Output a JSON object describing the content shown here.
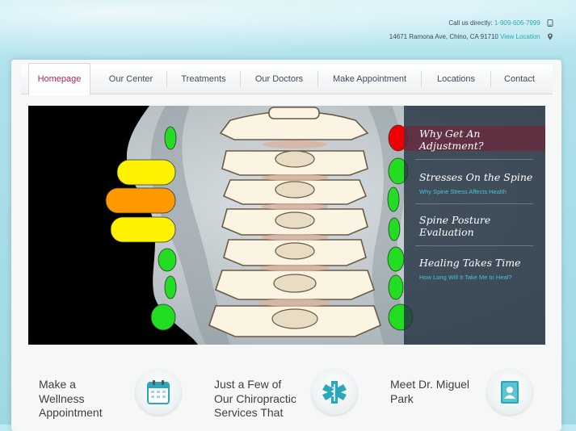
{
  "header": {
    "call_label": "Call us directly:",
    "phone": "1-909-606-7999",
    "address": "14671 Ramona Ave, Chino, CA 91710",
    "view_location": "View Location"
  },
  "nav": {
    "items": [
      {
        "label": "Homepage"
      },
      {
        "label": "Our Center"
      },
      {
        "label": "Treatments"
      },
      {
        "label": "Our Doctors"
      },
      {
        "label": "Make Appointment"
      },
      {
        "label": "Locations"
      },
      {
        "label": "Contact"
      }
    ],
    "active_index": 0
  },
  "slider": {
    "slides": [
      {
        "title_line1": "Why Get An",
        "title_line2": "Adjustment?",
        "subtitle": ""
      },
      {
        "title_line1": "Stresses On the Spine",
        "title_line2": "",
        "subtitle": "Why Spine Stress Affects Health"
      },
      {
        "title_line1": "Spine Posture",
        "title_line2": "Evaluation",
        "subtitle": ""
      },
      {
        "title_line1": "Healing Takes Time",
        "title_line2": "",
        "subtitle": "How Long Will It Take Me to Heal?"
      }
    ]
  },
  "features": [
    {
      "line1": "Make a",
      "line2": "Wellness",
      "line3": "Appointment",
      "icon": "calendar-icon"
    },
    {
      "line1": "Just a Few of",
      "line2": "Our Chiropractic",
      "line3": "Services That",
      "icon": "medical-icon"
    },
    {
      "line1": "Meet Dr. Miguel",
      "line2": "Park",
      "line3": "",
      "icon": "contact-book-icon"
    }
  ],
  "colors": {
    "accent": "#2aa7b8",
    "active_nav": "#b0245a",
    "indicator_green": "#22dd22",
    "indicator_yellow": "#fff200",
    "indicator_orange": "#ff9900",
    "indicator_red": "#ee0000"
  }
}
